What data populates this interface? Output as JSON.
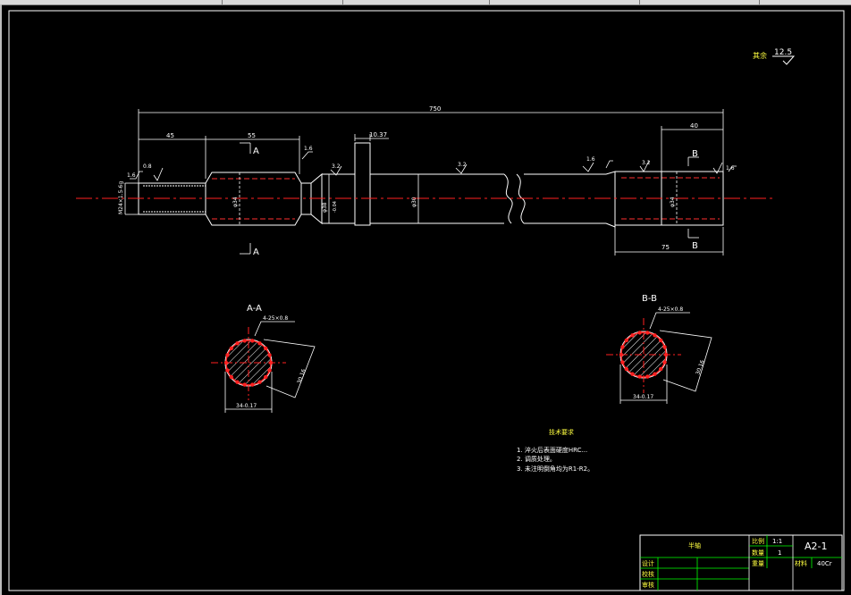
{
  "roughness": {
    "prefix": "其余",
    "value": "12.5"
  },
  "dims": {
    "overall_length": "750",
    "len_45": "45",
    "len_55": "55",
    "len_40": "40",
    "flange_thickness": "10.37",
    "len_75": "75",
    "r_16a": "1.6",
    "r_16b": "1.6",
    "r_16c": "1.6",
    "r_32a": "3.2",
    "r_32b": "3.2",
    "r_32c": "3.2",
    "r_16d": "1.6",
    "r_08": "0.8",
    "thread_dia": "M24×1.5-6g",
    "spline_dia_left": "φ34",
    "shaft_dia_a": "φ38",
    "shaft_dia_b": "φ30",
    "spline_dia_right": "φ34",
    "tol_zero": "0",
    "tol_neg": "-0.04"
  },
  "section_labels": {
    "a_top": "A",
    "a_bottom": "A",
    "b_top": "B",
    "b_bottom": "B"
  },
  "sections": {
    "aa_title": "A-A",
    "bb_title": "B-B",
    "aa_callout": "4-25×0.8",
    "bb_callout": "4-25×0.8",
    "aa_dim_outer": "34-0.17",
    "bb_dim_outer": "34-0.17",
    "aa_side": "30.16",
    "bb_side": "30.16"
  },
  "tech_req": {
    "title": "技术要求",
    "items": [
      "1.  淬火后表面硬度HRC...",
      "2.  调质处理。",
      "3.  未注明倒角均为R1-R2。"
    ]
  },
  "title_block": {
    "part_name": "半轴",
    "scale_label": "比例",
    "scale_value": "1:1",
    "qty_label": "数量",
    "qty_value": "1",
    "drawing_no": "A2-1",
    "weight_label": "重量",
    "material_label": "材料",
    "material_value": "40Cr",
    "designer_label": "设计",
    "checker_label": "校核",
    "approver_label": "审核"
  },
  "colors": {
    "line": "#ffffff",
    "center": "#ff2020",
    "hatch": "#ffffff",
    "grid": "#00ff00",
    "text_cn": "#ffff40"
  }
}
